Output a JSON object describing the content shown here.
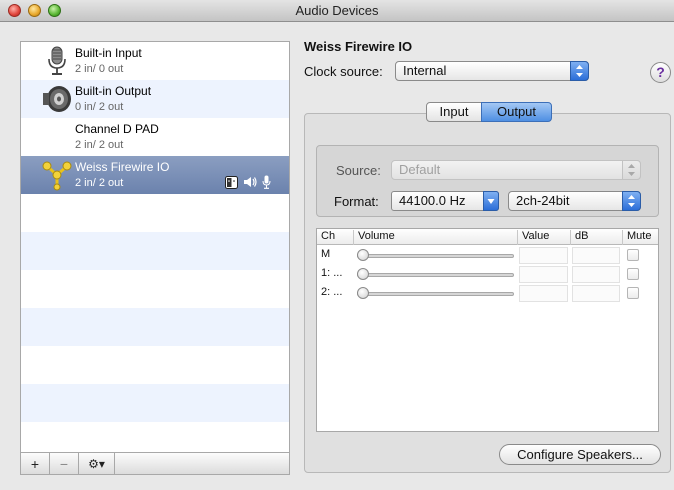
{
  "window": {
    "title": "Audio Devices"
  },
  "devices": [
    {
      "name": "Built-in Input",
      "channels": "2 in/ 0 out",
      "icon": "microphone-icon"
    },
    {
      "name": "Built-in Output",
      "channels": "0 in/ 2 out",
      "icon": "speaker-icon"
    },
    {
      "name": "Channel D PAD",
      "channels": "2 in/ 2 out",
      "icon": ""
    },
    {
      "name": "Weiss Firewire IO",
      "channels": "2 in/ 2 out",
      "icon": "firewire-icon",
      "selected": true,
      "status_icons": [
        "finder-icon",
        "speaker-volume-icon",
        "microphone-icon"
      ]
    }
  ],
  "toolbar": {
    "add": "+",
    "remove": "−",
    "gear": "⚙▾"
  },
  "detail": {
    "title": "Weiss Firewire IO",
    "clock_label": "Clock source:",
    "clock_value": "Internal",
    "help": "?",
    "tabs": {
      "input": "Input",
      "output": "Output",
      "active": "Output"
    },
    "source_label": "Source:",
    "source_value": "Default",
    "format_label": "Format:",
    "format_rate": "44100.0 Hz",
    "format_bits": "2ch-24bit",
    "table": {
      "headers": {
        "ch": "Ch",
        "volume": "Volume",
        "value": "Value",
        "db": "dB",
        "mute": "Mute"
      },
      "rows": [
        {
          "ch": "M"
        },
        {
          "ch": "1: ..."
        },
        {
          "ch": "2: ..."
        }
      ]
    },
    "configure_button": "Configure Speakers..."
  },
  "colors": {
    "selection": "#7a8fb8",
    "accent": "#3d7ee0",
    "stripe": "#edf3fe"
  }
}
